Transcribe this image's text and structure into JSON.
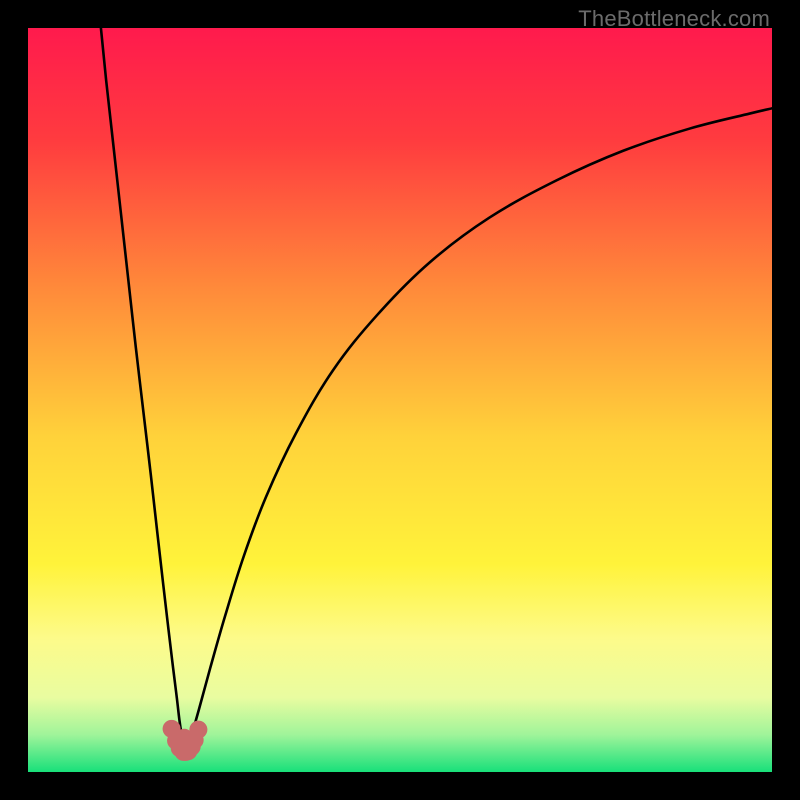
{
  "watermark": {
    "text": "TheBottleneck.com"
  },
  "chart_data": {
    "type": "line",
    "title": "",
    "xlabel": "",
    "ylabel": "",
    "xlim": [
      0,
      100
    ],
    "ylim": [
      0,
      100
    ],
    "grid": false,
    "legend": null,
    "annotations": [],
    "background_gradient": {
      "stops": [
        {
          "pos": 0.0,
          "color": "#ff1a4d"
        },
        {
          "pos": 0.15,
          "color": "#ff3b3f"
        },
        {
          "pos": 0.35,
          "color": "#ff8a3a"
        },
        {
          "pos": 0.55,
          "color": "#ffd23a"
        },
        {
          "pos": 0.72,
          "color": "#fff33a"
        },
        {
          "pos": 0.82,
          "color": "#fdfb8a"
        },
        {
          "pos": 0.9,
          "color": "#e9fca0"
        },
        {
          "pos": 0.95,
          "color": "#9ff49a"
        },
        {
          "pos": 1.0,
          "color": "#18e07a"
        }
      ]
    },
    "series": [
      {
        "name": "bottleneck-curve",
        "color": "#000000",
        "x": [
          9.8,
          10.5,
          11.5,
          12.5,
          13.5,
          14.5,
          15.5,
          16.5,
          17.4,
          18.2,
          18.9,
          19.5,
          20.0,
          20.35,
          20.65,
          20.9,
          21.1,
          21.25,
          21.5,
          22.0,
          23.0,
          24.5,
          26.5,
          29.0,
          32.0,
          36.0,
          41.0,
          47.0,
          54.0,
          62.0,
          71.0,
          80.0,
          89.0,
          97.0,
          100.0
        ],
        "y": [
          100.0,
          93.0,
          84.0,
          75.0,
          66.0,
          57.0,
          48.5,
          40.0,
          32.0,
          25.0,
          19.0,
          14.0,
          10.0,
          7.0,
          5.0,
          3.7,
          3.0,
          3.0,
          3.5,
          5.0,
          8.5,
          14.0,
          21.0,
          29.0,
          37.0,
          45.5,
          54.0,
          61.5,
          68.5,
          74.5,
          79.5,
          83.5,
          86.5,
          88.5,
          89.2
        ]
      }
    ],
    "markers": {
      "name": "minimum-cluster",
      "color": "#c96a6a",
      "x": [
        19.3,
        19.9,
        20.4,
        20.9,
        21.0,
        21.2,
        21.55,
        22.0,
        22.4,
        22.9
      ],
      "y": [
        5.8,
        4.2,
        3.2,
        2.7,
        4.6,
        2.7,
        2.8,
        3.4,
        4.3,
        5.7
      ]
    }
  }
}
